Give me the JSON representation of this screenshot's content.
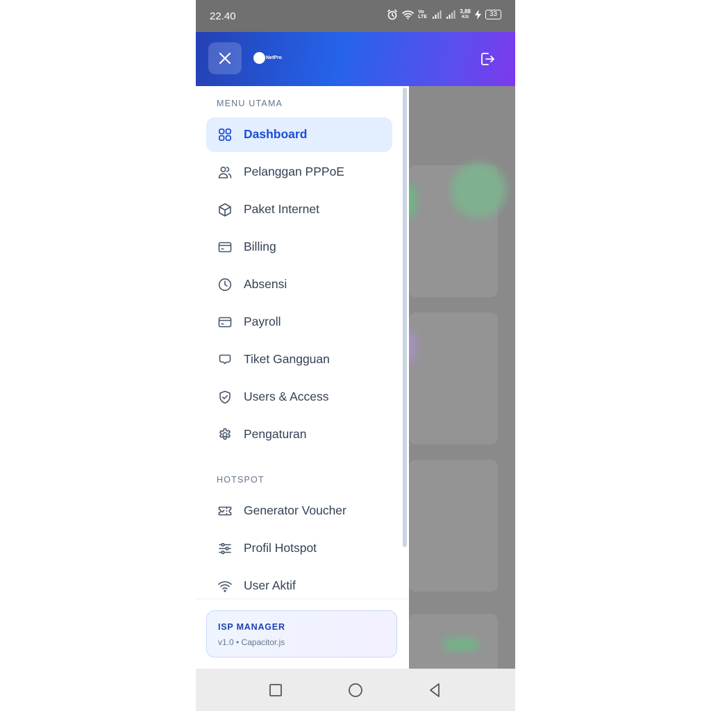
{
  "status_bar": {
    "time": "22.40",
    "network_speed": "3,88",
    "network_speed_unit": "K/S",
    "battery": "33",
    "lte_label": "Vo LTE"
  },
  "header": {
    "brand": "NetPro",
    "close_icon": "close-icon",
    "logout_icon": "logout-icon",
    "gradient_start": "#2440b3",
    "gradient_end": "#7c3aed"
  },
  "sidebar": {
    "sections": [
      {
        "title": "MENU UTAMA",
        "items": [
          {
            "label": "Dashboard",
            "icon": "grid-icon",
            "active": true
          },
          {
            "label": "Pelanggan PPPoE",
            "icon": "users-icon"
          },
          {
            "label": "Paket Internet",
            "icon": "package-icon"
          },
          {
            "label": "Billing",
            "icon": "credit-card-icon"
          },
          {
            "label": "Absensi",
            "icon": "clock-icon"
          },
          {
            "label": "Payroll",
            "icon": "credit-card-icon"
          },
          {
            "label": "Tiket Gangguan",
            "icon": "message-icon"
          },
          {
            "label": "Users & Access",
            "icon": "shield-check-icon"
          },
          {
            "label": "Pengaturan",
            "icon": "gear-icon"
          }
        ]
      },
      {
        "title": "HOTSPOT",
        "items": [
          {
            "label": "Generator Voucher",
            "icon": "ticket-icon"
          },
          {
            "label": "Profil Hotspot",
            "icon": "sliders-icon"
          },
          {
            "label": "User Aktif",
            "icon": "wifi-icon"
          }
        ]
      }
    ]
  },
  "footer": {
    "title": "ISP MANAGER",
    "subtitle": "v1.0 • Capacitor.js"
  },
  "colors": {
    "accent": "#1d4ed8",
    "active_bg": "#e3eeff",
    "text": "#334155",
    "muted": "#64748b"
  }
}
